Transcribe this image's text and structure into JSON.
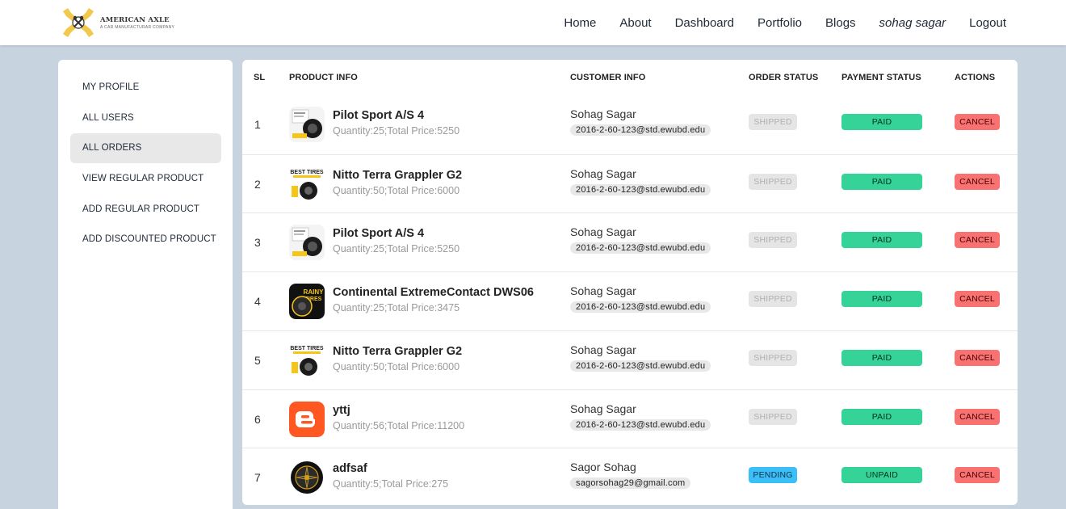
{
  "brand": {
    "name": "AMERICAN AXLE",
    "tagline": "A CAR MANUFACTURAR COMPANY",
    "accent": "#f2c94c"
  },
  "nav": {
    "items": [
      "Home",
      "About",
      "Dashboard",
      "Portfolio",
      "Blogs"
    ],
    "user": "sohag sagar",
    "logout": "Logout"
  },
  "sidebar": {
    "items": [
      "MY PROFILE",
      "ALL USERS",
      "ALL ORDERS",
      "VIEW REGULAR PRODUCT",
      "ADD REGULAR PRODUCT",
      "ADD DISCOUNTED PRODUCT"
    ],
    "active": "ALL ORDERS"
  },
  "table": {
    "headers": [
      "SL",
      "PRODUCT INFO",
      "CUSTOMER INFO",
      "ORDER STATUS",
      "PAYMENT STATUS",
      "ACTIONS"
    ],
    "cancel_label": "CANCEL",
    "rows": [
      {
        "sl": "1",
        "thumb": "tire-white-icon",
        "product": "Pilot Sport A/S 4",
        "meta": "Quantity:25;Total Price:5250",
        "customer": "Sohag Sagar",
        "email": "2016-2-60-123@std.ewubd.edu",
        "order_status": "SHIPPED",
        "payment": "PAID"
      },
      {
        "sl": "2",
        "thumb": "best-tires-icon",
        "product": "Nitto Terra Grappler G2",
        "meta": "Quantity:50;Total Price:6000",
        "customer": "Sohag Sagar",
        "email": "2016-2-60-123@std.ewubd.edu",
        "order_status": "SHIPPED",
        "payment": "PAID"
      },
      {
        "sl": "3",
        "thumb": "tire-white-icon",
        "product": "Pilot Sport A/S 4",
        "meta": "Quantity:25;Total Price:5250",
        "customer": "Sohag Sagar",
        "email": "2016-2-60-123@std.ewubd.edu",
        "order_status": "SHIPPED",
        "payment": "PAID"
      },
      {
        "sl": "4",
        "thumb": "rainy-tires-icon",
        "product": "Continental ExtremeContact DWS06",
        "meta": "Quantity:25;Total Price:3475",
        "customer": "Sohag Sagar",
        "email": "2016-2-60-123@std.ewubd.edu",
        "order_status": "SHIPPED",
        "payment": "PAID"
      },
      {
        "sl": "5",
        "thumb": "best-tires-icon",
        "product": "Nitto Terra Grappler G2",
        "meta": "Quantity:50;Total Price:6000",
        "customer": "Sohag Sagar",
        "email": "2016-2-60-123@std.ewubd.edu",
        "order_status": "SHIPPED",
        "payment": "PAID"
      },
      {
        "sl": "6",
        "thumb": "blogger-icon",
        "product": "yttj",
        "meta": "Quantity:56;Total Price:11200",
        "customer": "Sohag Sagar",
        "email": "2016-2-60-123@std.ewubd.edu",
        "order_status": "SHIPPED",
        "payment": "PAID"
      },
      {
        "sl": "7",
        "thumb": "alloy-wheel-icon",
        "product": "adfsaf",
        "meta": "Quantity:5;Total Price:275",
        "customer": "Sagor Sohag",
        "email": "sagorsohag29@gmail.com",
        "order_status": "PENDING",
        "payment": "UNPAID"
      }
    ]
  },
  "colors": {
    "background": "#c8d3e0",
    "paid": "#36d399",
    "cancel": "#f87272",
    "pending": "#3abff8",
    "shipped": "#e5e5e5"
  }
}
